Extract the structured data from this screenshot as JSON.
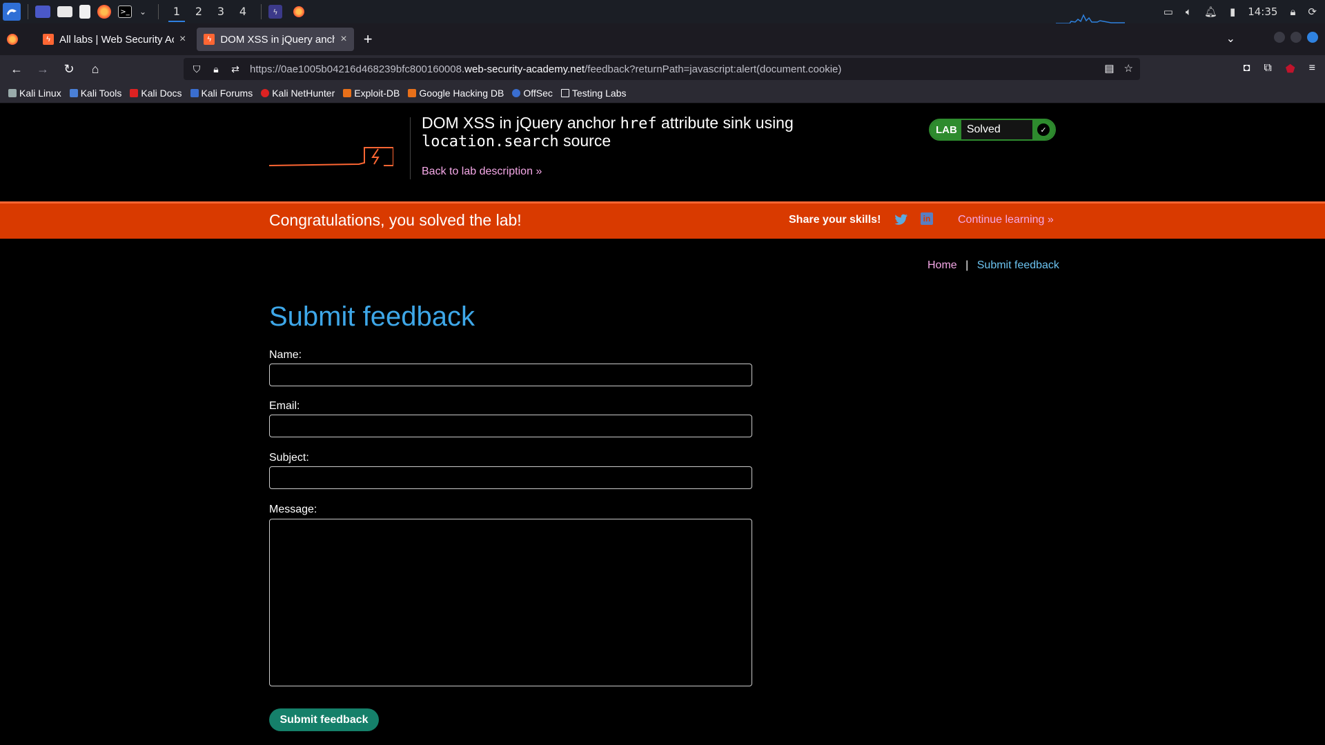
{
  "taskbar": {
    "workspaces": [
      "1",
      "2",
      "3",
      "4"
    ],
    "clock": "14:35"
  },
  "tabs": [
    {
      "title": "All labs | Web Security Ac",
      "close": "×"
    },
    {
      "title": "DOM XSS in jQuery ancho",
      "close": "×"
    }
  ],
  "newtab": "+",
  "url": {
    "prefix": "https://0ae1005b04216d468239bfc800160008.",
    "domain": "web-security-academy.net",
    "path": "/feedback?returnPath=javascript:alert(document.cookie)"
  },
  "bookmarks": [
    "Kali Linux",
    "Kali Tools",
    "Kali Docs",
    "Kali Forums",
    "Kali NetHunter",
    "Exploit-DB",
    "Google Hacking DB",
    "OffSec",
    "Testing Labs"
  ],
  "lab": {
    "title_pre": "DOM XSS in jQuery anchor ",
    "title_code1": "href",
    "title_mid": " attribute sink using ",
    "title_code2": "location.search",
    "title_post": " source",
    "back_link": "Back to lab description",
    "badge": "LAB",
    "status": "Solved"
  },
  "banner": {
    "message": "Congratulations, you solved the lab!",
    "share": "Share your skills!",
    "continue": "Continue learning"
  },
  "breadcrumbs": {
    "home": "Home",
    "sep": "|",
    "current": "Submit feedback"
  },
  "form": {
    "title": "Submit feedback",
    "name_label": "Name:",
    "email_label": "Email:",
    "subject_label": "Subject:",
    "message_label": "Message:",
    "submit": "Submit feedback"
  },
  "colors": {
    "accent_blue": "#3ea7e8",
    "link_pink": "#f5a8e7",
    "banner_orange": "#d93a00",
    "lab_green": "#2e8b2e",
    "button_teal": "#15806a"
  }
}
